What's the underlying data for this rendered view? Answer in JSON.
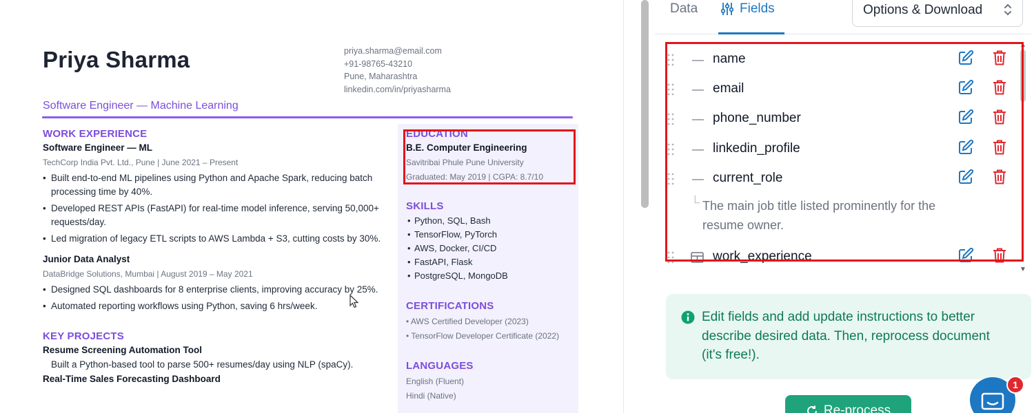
{
  "resume": {
    "name": "Priya Sharma",
    "contact": {
      "email": "priya.sharma@email.com",
      "phone": "+91-98765-43210",
      "location": "Pune, Maharashtra",
      "linkedin": "linkedin.com/in/priyasharma"
    },
    "role_title": "Software Engineer — Machine Learning",
    "work_experience": {
      "heading": "WORK EXPERIENCE",
      "jobs": [
        {
          "title": "Software Engineer — ML",
          "meta": "TechCorp India Pvt. Ltd., Pune | June 2021 – Present",
          "bullets": [
            "Built end-to-end ML pipelines using Python and Apache Spark, reducing batch processing time by 40%.",
            "Developed REST APIs (FastAPI) for real-time model inference, serving 50,000+ requests/day.",
            "Led migration of legacy ETL scripts to AWS Lambda + S3, cutting costs by 30%."
          ]
        },
        {
          "title": "Junior Data Analyst",
          "meta": "DataBridge Solutions, Mumbai | August 2019 – May 2021",
          "bullets": [
            "Designed SQL dashboards for 8 enterprise clients, improving accuracy by 25%.",
            "Automated reporting workflows using Python, saving 6 hrs/week."
          ]
        }
      ]
    },
    "key_projects": {
      "heading": "KEY PROJECTS",
      "projects": [
        {
          "title": "Resume Screening Automation Tool",
          "text": "Built a Python-based tool to parse 500+ resumes/day using NLP (spaCy)."
        },
        {
          "title": "Real-Time Sales Forecasting Dashboard"
        }
      ]
    },
    "education": {
      "heading": "EDUCATION",
      "degree": "B.E. Computer Engineering",
      "school": "Savitribai Phule Pune University",
      "details": "Graduated: May 2019 | CGPA: 8.7/10"
    },
    "skills": {
      "heading": "SKILLS",
      "items": [
        "Python, SQL, Bash",
        "TensorFlow, PyTorch",
        "AWS, Docker, CI/CD",
        "FastAPI, Flask",
        "PostgreSQL, MongoDB"
      ]
    },
    "certifications": {
      "heading": "CERTIFICATIONS",
      "items": [
        "• AWS Certified Developer (2023)",
        "• TensorFlow Developer Certificate (2022)"
      ]
    },
    "languages": {
      "heading": "LANGUAGES",
      "items": [
        "English (Fluent)",
        "Hindi (Native)"
      ]
    }
  },
  "panel": {
    "tabs": [
      {
        "label": "Data",
        "active": false
      },
      {
        "label": "Fields",
        "active": true,
        "icon": "sliders-icon"
      }
    ],
    "options_button": "Options & Download",
    "fields": [
      {
        "name": "name",
        "type": "text"
      },
      {
        "name": "email",
        "type": "text"
      },
      {
        "name": "phone_number",
        "type": "text"
      },
      {
        "name": "linkedin_profile",
        "type": "text"
      },
      {
        "name": "current_role",
        "type": "text",
        "description": "The main job title listed prominently for the resume owner."
      },
      {
        "name": "work_experience",
        "type": "table"
      }
    ],
    "info_message": "Edit fields and add update instructions to better describe desired data. Then, reprocess document (it's free!).",
    "reprocess_button": "Re-process",
    "chat_badge_count": "1"
  },
  "colors": {
    "accent_purple": "#7c4ddb",
    "accent_blue": "#1d77c2",
    "delete_red": "#e0282e",
    "info_green": "#0f7a56",
    "info_bg": "#e8f7f1",
    "highlight_red": "#e3141b",
    "sidebar_bg": "#f3f1fd"
  }
}
